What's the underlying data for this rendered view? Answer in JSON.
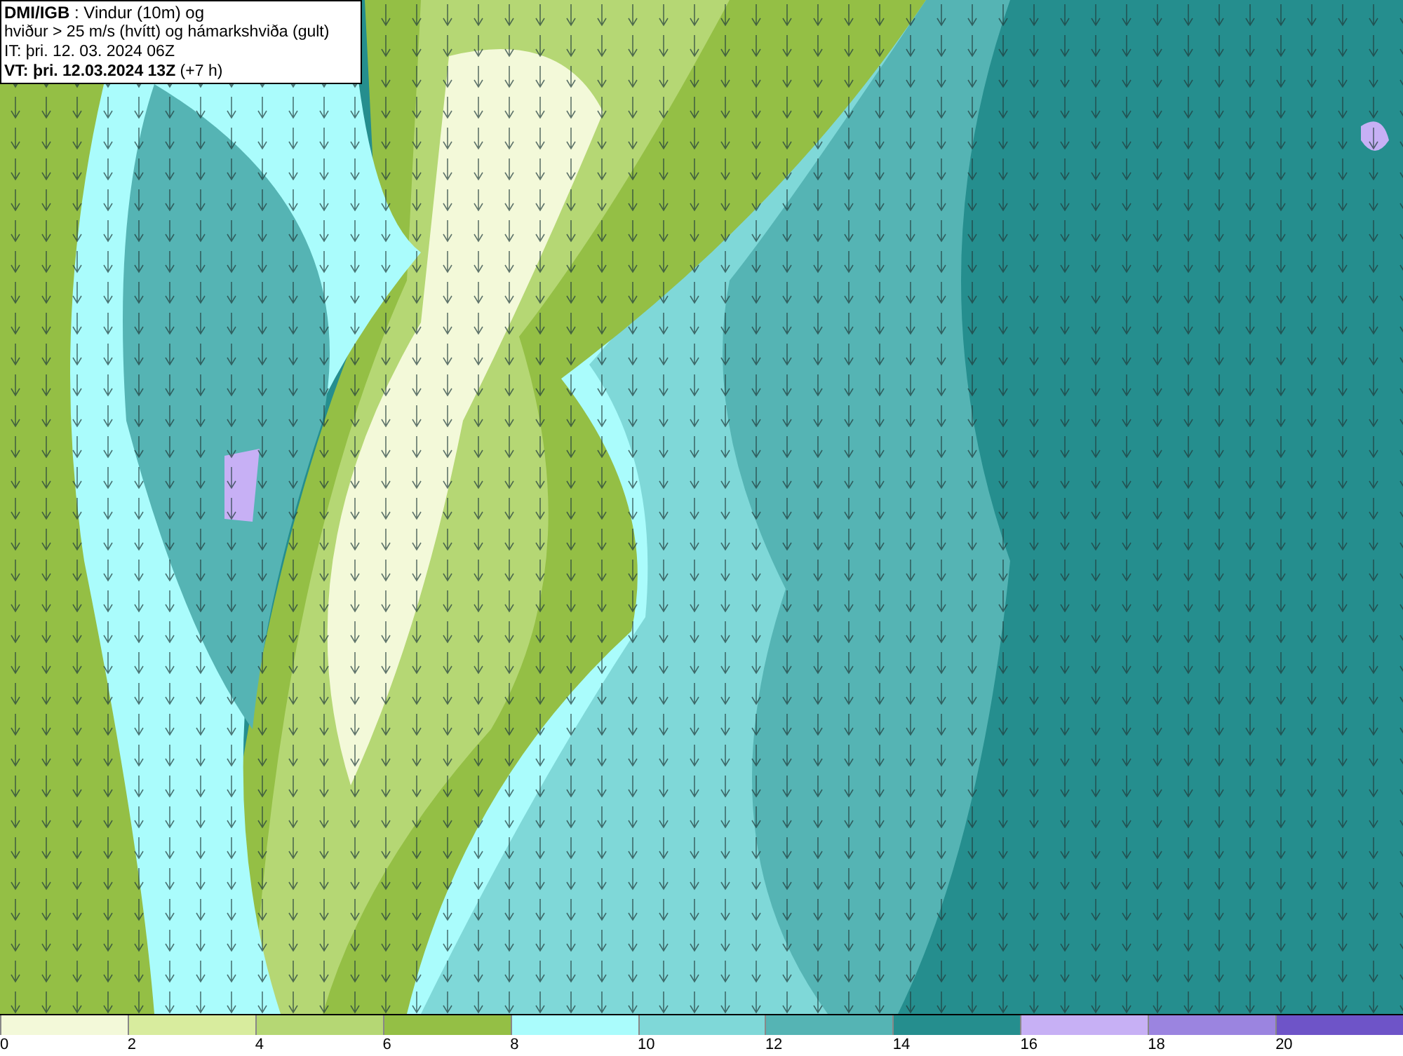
{
  "header": {
    "lines": [
      "**DMI/IGB** : Vindur (10m) og",
      "hviður > 25 m/s (hvítt) og hámarkshviða (gult)",
      "IT: þri. 12. 03. 2024 06Z",
      "**VT: þri. 12.03.2024 13Z** (+7 h)"
    ]
  },
  "legend": [
    {
      "label": "0",
      "color": "#f3f9d9"
    },
    {
      "label": "2",
      "color": "#d8ec9e"
    },
    {
      "label": "4",
      "color": "#b5d774"
    },
    {
      "label": "6",
      "color": "#94bf45"
    },
    {
      "label": "8",
      "color": "#aafcfc"
    },
    {
      "label": "10",
      "color": "#7fd8d8"
    },
    {
      "label": "12",
      "color": "#55b4b4"
    },
    {
      "label": "14",
      "color": "#258e8e"
    },
    {
      "label": "16",
      "color": "#c7b0f5"
    },
    {
      "label": "18",
      "color": "#9b84e0"
    },
    {
      "label": "20",
      "color": "#6e54c8"
    }
  ]
}
